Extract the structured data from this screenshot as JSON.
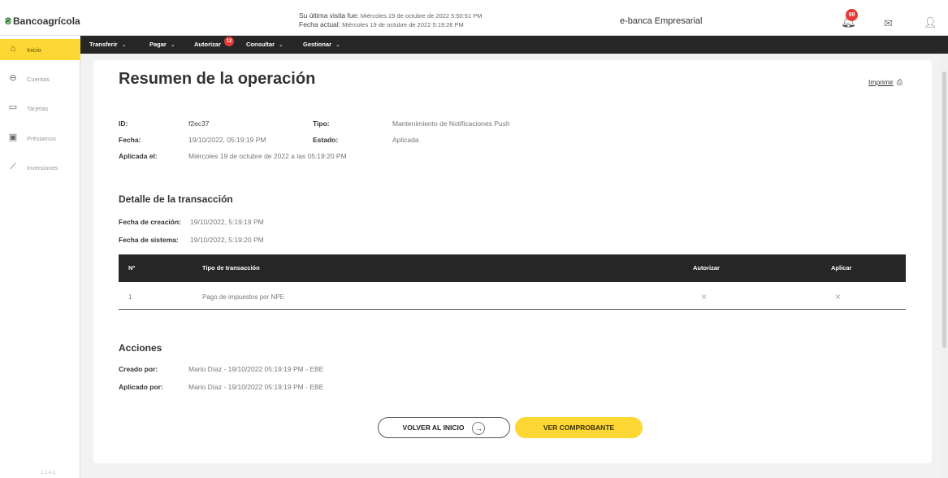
{
  "header": {
    "brand": "Bancoagrícola",
    "brand_icon": "bank-logo-icon",
    "last_visit_label": "Su última visita fue:",
    "last_visit_value": "Miércoles 19 de octubre de 2022 5:50:51 PM",
    "current_date_label": "Fecha actual:",
    "current_date_value": "Miércoles 19 de octubre de 2022 5:19:26 PM",
    "app_title": "e-banca Empresarial",
    "notifications_badge": "99",
    "icons": [
      "bell-icon",
      "mail-icon",
      "user-icon"
    ]
  },
  "sidebar": {
    "items": [
      {
        "label": "Inicio",
        "icon": "home-icon",
        "active": true
      },
      {
        "label": "Cuentas",
        "icon": "wallet-icon",
        "active": false
      },
      {
        "label": "Tarjetas",
        "icon": "card-icon",
        "active": false
      },
      {
        "label": "Préstamos",
        "icon": "loan-icon",
        "active": false
      },
      {
        "label": "Inversiones",
        "icon": "chart-icon",
        "active": false
      }
    ],
    "version": "1.2.4.1"
  },
  "menu": {
    "items": [
      {
        "label": "Transferir",
        "has_chevron": true
      },
      {
        "label": "Pagar",
        "has_chevron": true
      },
      {
        "label": "Autorizar",
        "has_chevron": false,
        "badge": "12"
      },
      {
        "label": "Consultar",
        "has_chevron": true
      },
      {
        "label": "Gestionar",
        "has_chevron": true
      }
    ]
  },
  "main": {
    "title": "Resumen de la operación",
    "print_label": "Imprimir",
    "summary": {
      "id_label": "ID:",
      "id_value": "f2ec37",
      "tipo_label": "Tipo:",
      "tipo_value": "Mantenimiento de Notificaciones Push",
      "fecha_label": "Fecha:",
      "fecha_value": "19/10/2022, 05:19:19 PM",
      "estado_label": "Estado:",
      "estado_value": "Aplicada",
      "aplicada_label": "Aplicada el:",
      "aplicada_value": "Miércoles 19 de octubre de 2022 a las 05:19:20 PM"
    },
    "detail": {
      "title": "Detalle de la transacción",
      "creation_label": "Fecha de creación:",
      "creation_value": "19/10/2022, 5:19:19 PM",
      "system_label": "Fecha de sistema:",
      "system_value": "19/10/2022, 5:19:20 PM"
    },
    "table": {
      "columns": [
        "Nº",
        "Tipo de transacción",
        "Autorizar",
        "Aplicar"
      ],
      "rows": [
        {
          "n": "1",
          "tipo": "Pago de impuestos por NPE",
          "autorizar": "×",
          "aplicar": "×"
        }
      ]
    },
    "actions": {
      "title": "Acciones",
      "created_label": "Creado por:",
      "created_value": "Mario Díaz - 19/10/2022 05:19:19 PM - EBE",
      "applied_label": "Aplicado por:",
      "applied_value": "Mario Díaz - 19/10/2022 05:19:19 PM - EBE"
    },
    "buttons": {
      "back_label": "VOLVER AL INICIO",
      "receipt_label": "VER COMPROBANTE"
    }
  },
  "colors": {
    "accent": "#fdd835",
    "dark_bar": "#262626",
    "badge": "#e53935",
    "brand_green": "#2e7d32"
  }
}
